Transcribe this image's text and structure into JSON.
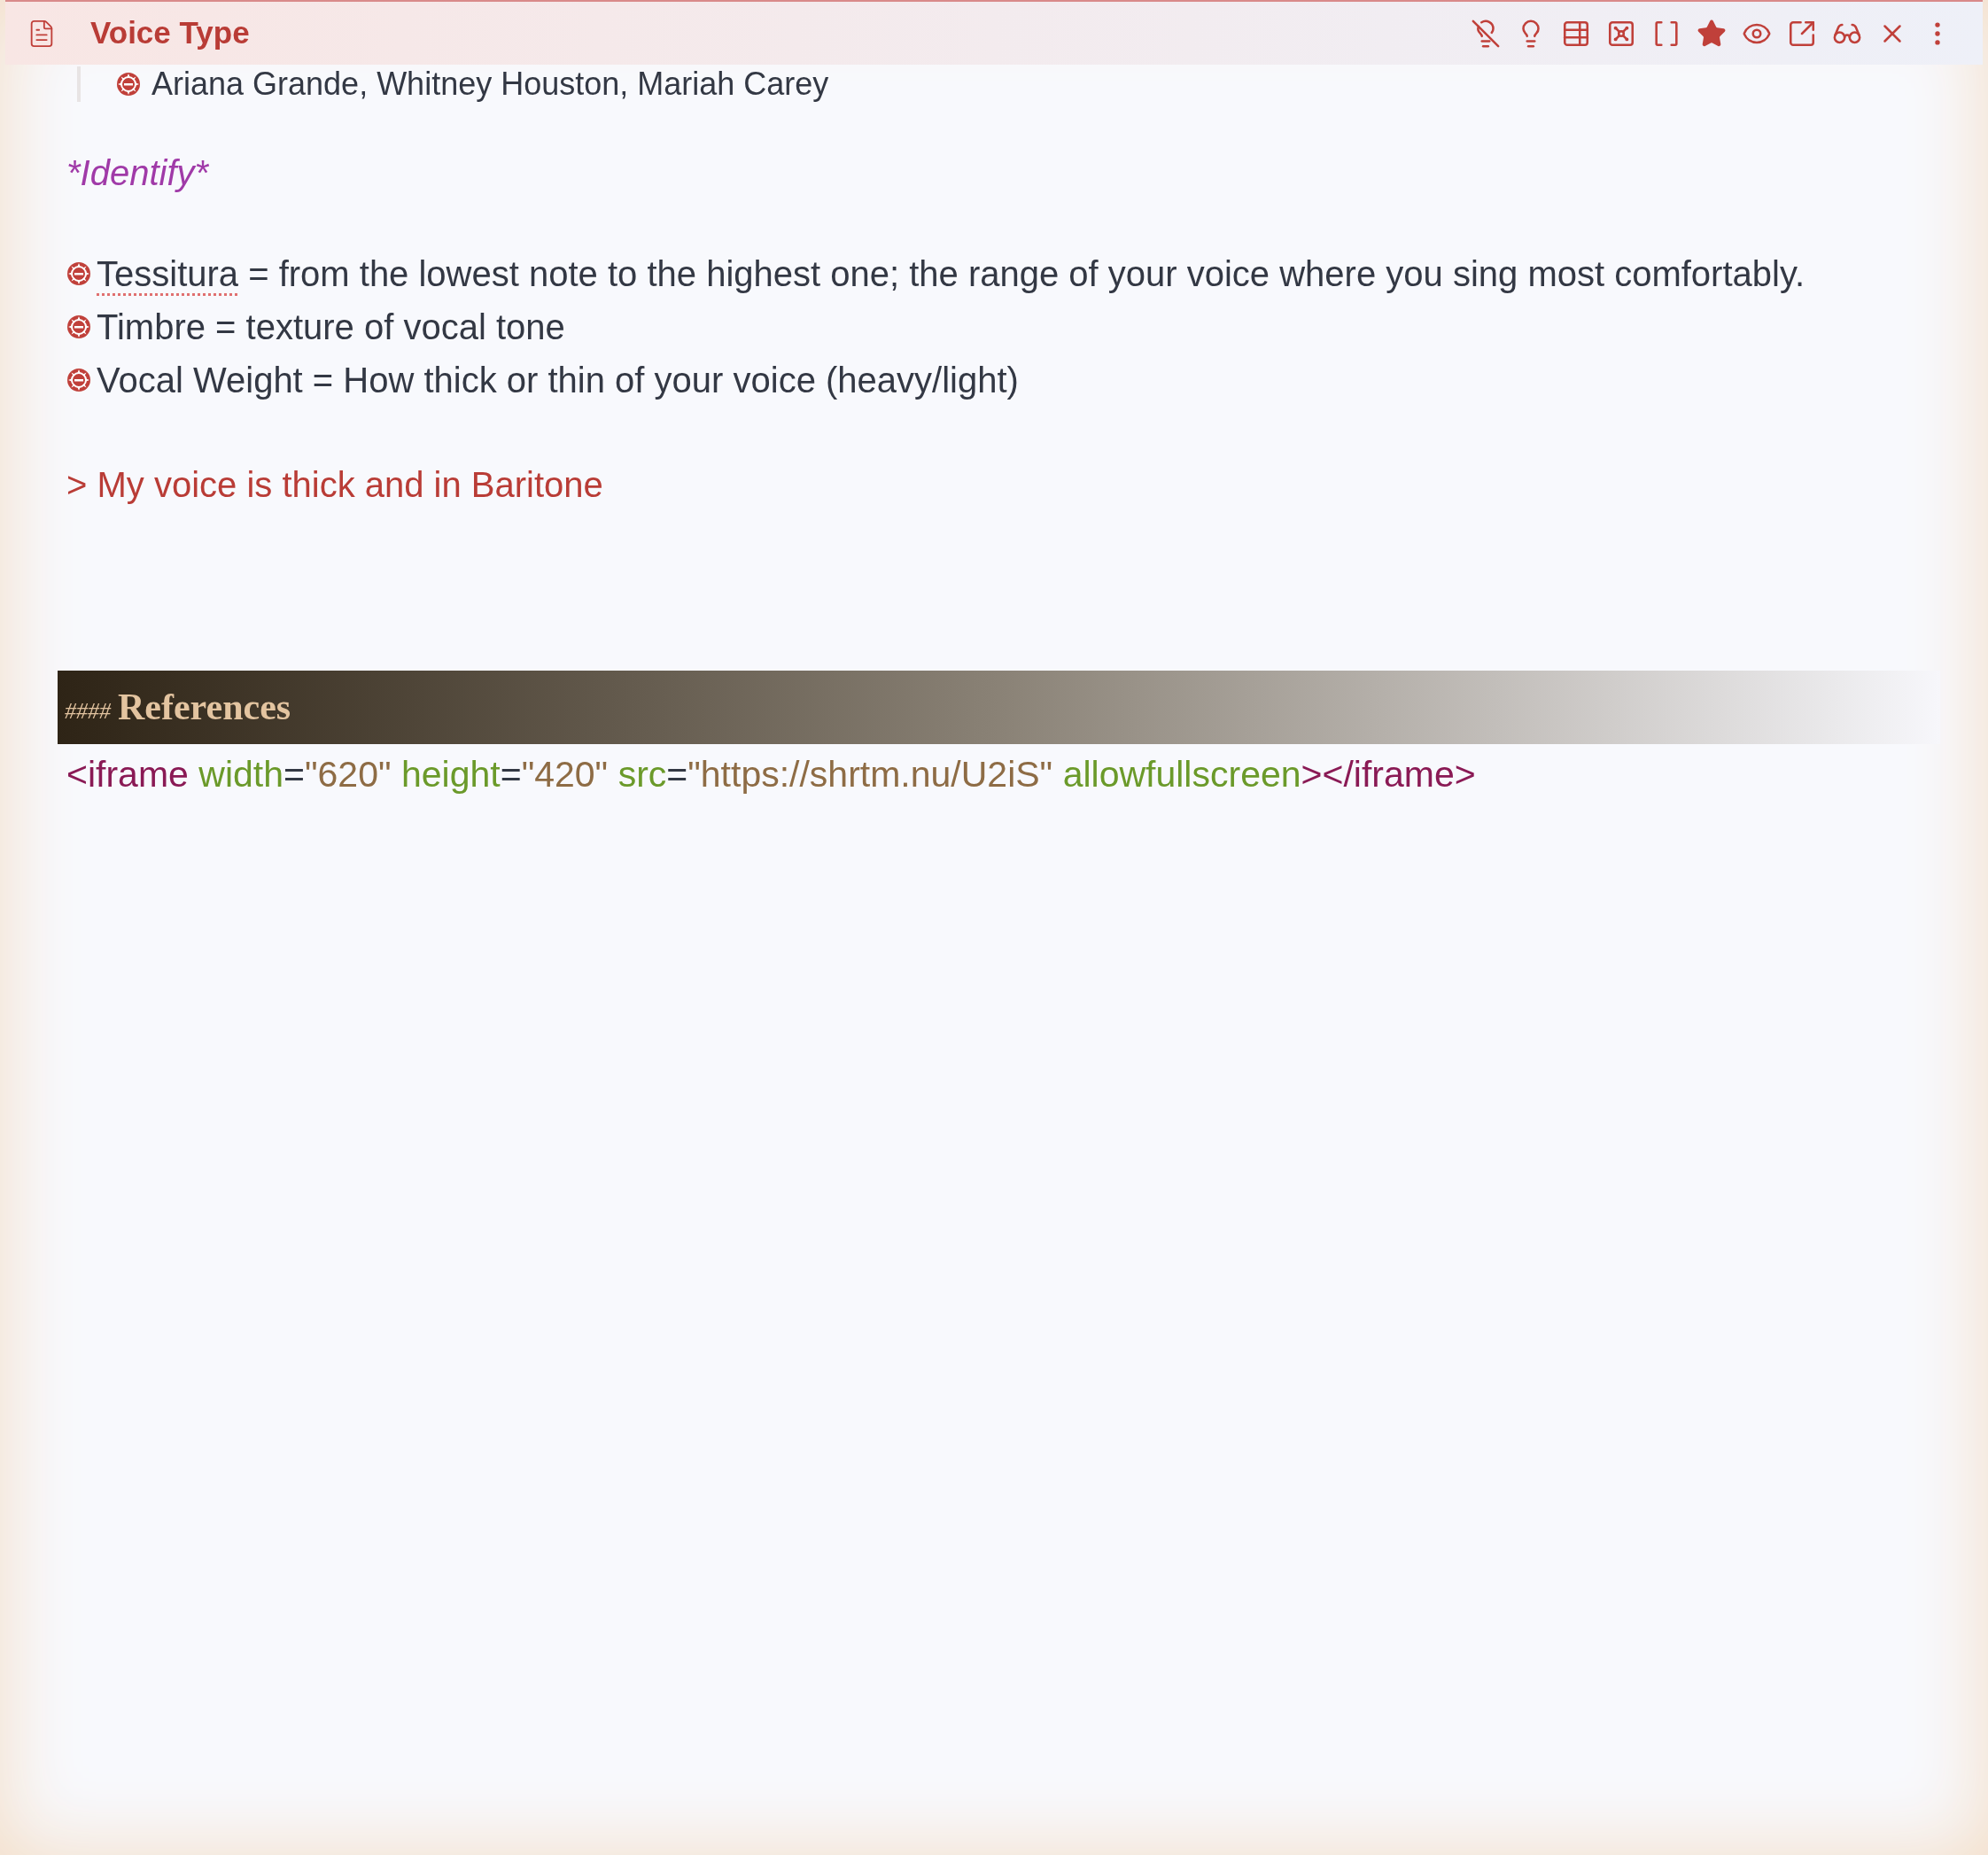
{
  "tab": {
    "title": "Voice Type"
  },
  "note": {
    "quote_line": "Ariana Grande, Whitney Houston, Mariah Carey",
    "emphasis": "*Identify*",
    "definitions": [
      {
        "term": "Tessitura",
        "flagged": true,
        "rest": " = from the lowest note to the highest one; the range of your voice where you sing most comfortably."
      },
      {
        "term": "Timbre",
        "flagged": false,
        "rest": " = texture of vocal tone"
      },
      {
        "term": "Vocal Weight",
        "flagged": false,
        "rest": " = How thick or thin of your voice (heavy/light)"
      }
    ],
    "blockquote": "> My voice is thick and in Baritone",
    "heading": {
      "marker": "####",
      "text": "References"
    },
    "code_line": [
      {
        "kind": "tag",
        "text": "<iframe"
      },
      {
        "kind": "attr",
        "text": "width"
      },
      {
        "kind": "punct",
        "text": "="
      },
      {
        "kind": "value",
        "text": "\"620\""
      },
      {
        "kind": "attr",
        "text": "height"
      },
      {
        "kind": "punct",
        "text": "="
      },
      {
        "kind": "value",
        "text": "\"420\""
      },
      {
        "kind": "attr",
        "text": "src"
      },
      {
        "kind": "punct",
        "text": "="
      },
      {
        "kind": "value",
        "text": "\"https://shrtm.nu/U2iS\""
      },
      {
        "kind": "attr",
        "text": "allowfullscreen"
      },
      {
        "kind": "tag",
        "text": "></iframe>"
      }
    ]
  }
}
